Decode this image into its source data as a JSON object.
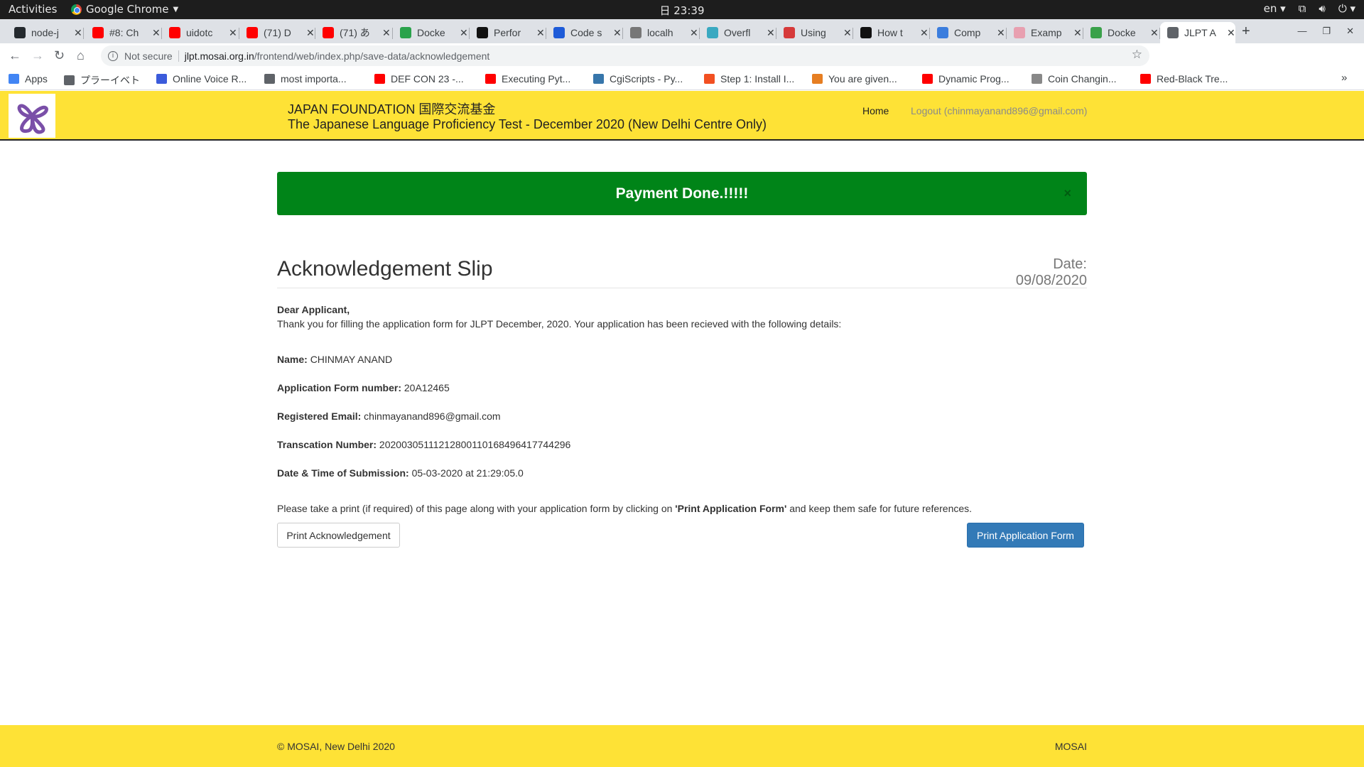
{
  "os_bar": {
    "activities": "Activities",
    "app_name": "Google Chrome",
    "clock": "日 23:39",
    "lang": "en"
  },
  "tabs": [
    {
      "label": "node-j",
      "color": "#24292e"
    },
    {
      "label": "#8: Ch",
      "color": "#ff0000"
    },
    {
      "label": "uidotc",
      "color": "#ff0000"
    },
    {
      "label": "(71) D",
      "color": "#ff0000"
    },
    {
      "label": "(71) あ",
      "color": "#ff0000"
    },
    {
      "label": "Docke",
      "color": "#2aa24b"
    },
    {
      "label": "Perfor",
      "color": "#111111"
    },
    {
      "label": "Code s",
      "color": "#1e5bd8"
    },
    {
      "label": "localh",
      "color": "#777777"
    },
    {
      "label": "Overfl",
      "color": "#3aa9c1"
    },
    {
      "label": "Using",
      "color": "#d63a3a"
    },
    {
      "label": "How t",
      "color": "#111111"
    },
    {
      "label": "Comp",
      "color": "#3b7ddd"
    },
    {
      "label": "Examp",
      "color": "#e8a0b0"
    },
    {
      "label": "Docke",
      "color": "#3aa14a"
    },
    {
      "label": "JLPT A",
      "color": "#5f6368"
    }
  ],
  "address_bar": {
    "security_label": "Not secure",
    "url_host": "jlpt.mosai.org.in",
    "url_path": "/frontend/web/index.php/save-data/acknowledgement"
  },
  "bookmarks": [
    {
      "label": "Apps",
      "color": "#4285f4"
    },
    {
      "label": "プラーイベト",
      "color": "#5f6368"
    },
    {
      "label": "Online Voice R...",
      "color": "#3b5bdb"
    },
    {
      "label": "most importa...",
      "color": "#5f6368"
    },
    {
      "label": "DEF CON 23 -...",
      "color": "#ff0000"
    },
    {
      "label": "Executing Pyt...",
      "color": "#ff0000"
    },
    {
      "label": "CgiScripts - Py...",
      "color": "#3776ab"
    },
    {
      "label": "Step 1: Install I...",
      "color": "#f25022"
    },
    {
      "label": "You are given...",
      "color": "#e67e22"
    },
    {
      "label": "Dynamic Prog...",
      "color": "#ff0000"
    },
    {
      "label": "Coin Changin...",
      "color": "#888888"
    },
    {
      "label": "Red-Black Tre...",
      "color": "#ff0000"
    }
  ],
  "header": {
    "title_line1": "JAPAN FOUNDATION 国際交流基金",
    "title_line2": "The Japanese Language Proficiency Test - December 2020 (New Delhi Centre Only)",
    "nav_home": "Home",
    "nav_logout": "Logout (chinmayanand896@gmail.com)"
  },
  "alert": {
    "message": "Payment Done.!!!!!",
    "close": "×"
  },
  "slip": {
    "title": "Acknowledgement Slip",
    "date": "Date: 09/08/2020",
    "greeting": "Dear Applicant,",
    "intro": "Thank you for filling the application form for JLPT December, 2020. Your application has been recieved with the following details:",
    "fields": [
      {
        "label": "Name:",
        "value": "CHINMAY ANAND"
      },
      {
        "label": "Application Form number:",
        "value": "20A12465"
      },
      {
        "label": "Registered Email:",
        "value": "chinmayanand896@gmail.com"
      },
      {
        "label": "Transcation Number:",
        "value": "202003051112128001101684964177442​96"
      },
      {
        "label": "Date & Time of Submission:",
        "value": "05-03-2020 at 21:29:05.0"
      }
    ],
    "note_prefix": "Please take a print (if required) of this page along with your application form by clicking on ",
    "note_bold": "'Print Application Form'",
    "note_suffix": " and keep them safe for future references.",
    "btn_print_ack": "Print Acknowledgement",
    "btn_print_form": "Print Application Form"
  },
  "footer": {
    "copyright": "© MOSAI, New Delhi 2020",
    "brand": "MOSAI"
  }
}
